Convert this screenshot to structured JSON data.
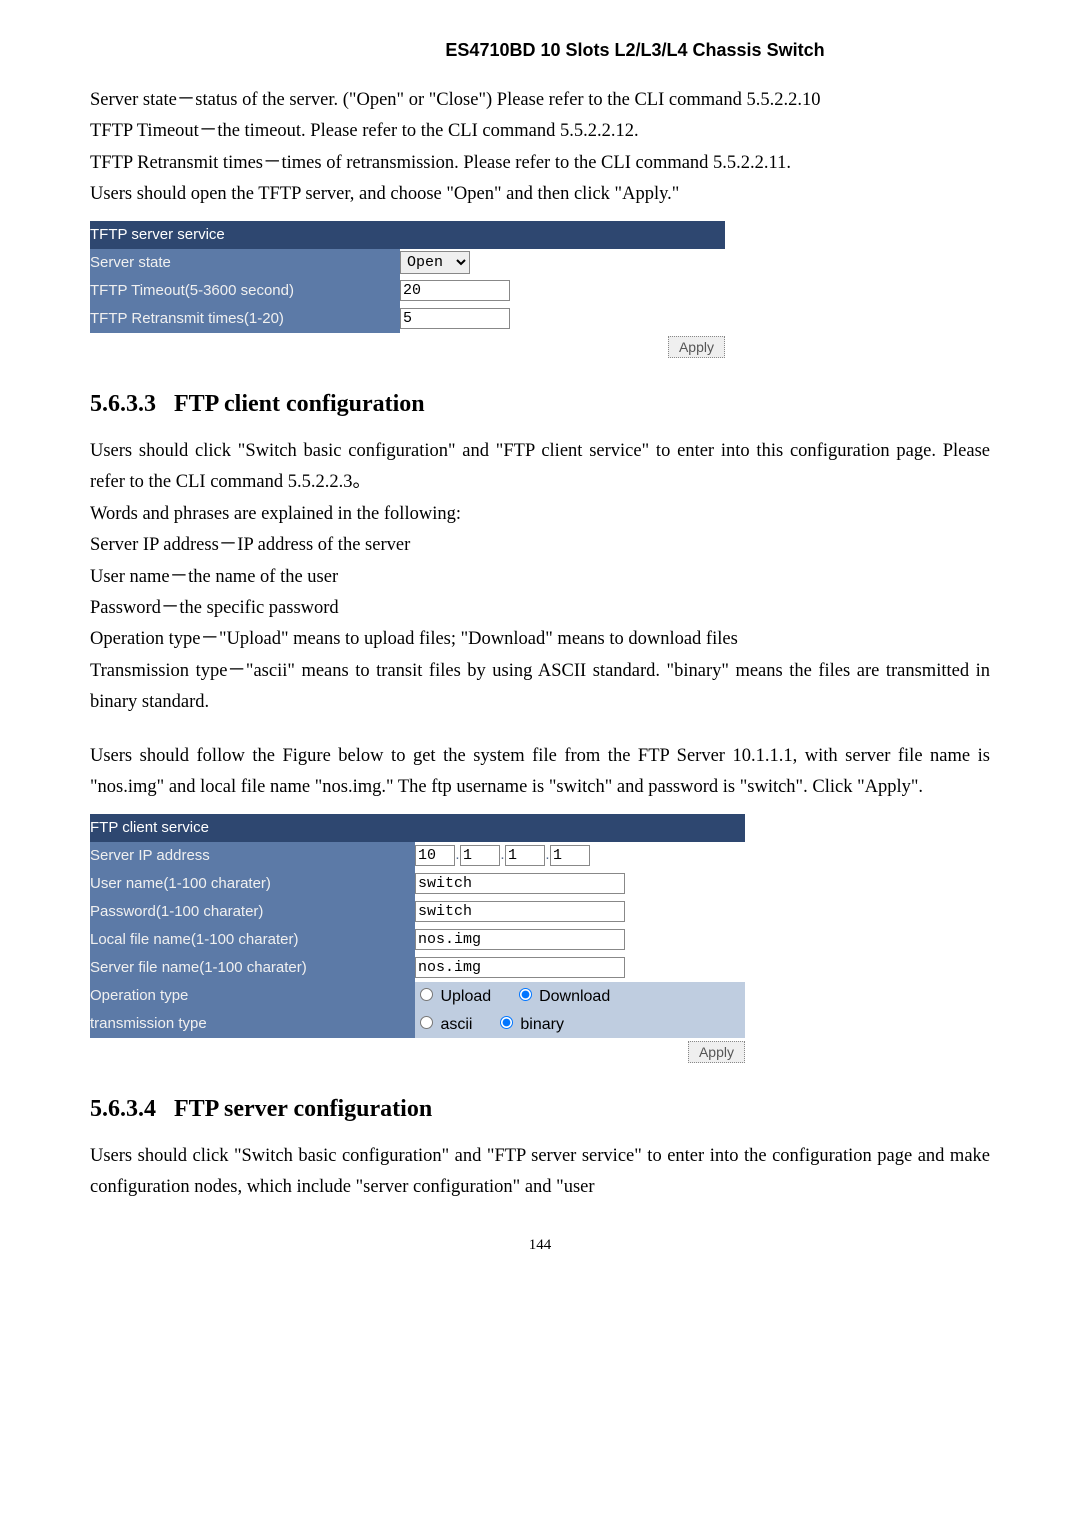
{
  "header": {
    "title": "ES4710BD 10 Slots L2/L3/L4 Chassis Switch"
  },
  "intro": {
    "p1": "Server state－status of the server. (\"Open\" or \"Close\") Please refer to the CLI command 5.5.2.2.10",
    "p2": "TFTP Timeout－the timeout. Please refer to the CLI command 5.5.2.2.12.",
    "p3": "TFTP Retransmit times－times of retransmission. Please refer to the CLI command 5.5.2.2.11.",
    "p4": "Users should open the TFTP server, and choose \"Open\" and then click \"Apply.\""
  },
  "tftp": {
    "title": "TFTP server service",
    "rows": {
      "state_label": "Server state",
      "state_value": "Open",
      "timeout_label": "TFTP Timeout(5-3600 second)",
      "timeout_value": "20",
      "retrans_label": "TFTP Retransmit times(1-20)",
      "retrans_value": "5"
    },
    "apply": "Apply"
  },
  "sec563_3": {
    "num": "5.6.3.3",
    "title": "FTP client configuration",
    "p1": "Users should click \"Switch basic configuration\" and \"FTP client service\" to enter into this configuration page. Please refer to the CLI command 5.5.2.2.3。",
    "p2": "Words and phrases are explained in the following:",
    "p3": "Server IP address－IP address of the server",
    "p4": "User name－the name of the user",
    "p5": "Password－the specific password",
    "p6": "Operation type－\"Upload\" means to upload files; \"Download\" means to download files",
    "p7": "Transmission type－\"ascii\" means to transit files by using ASCII standard. \"binary\" means the files are transmitted in binary standard.",
    "p8": "Users should follow the Figure below to get the system file from the FTP Server 10.1.1.1, with server file name is \"nos.img\" and local file name \"nos.img.\" The ftp username is \"switch\" and password is \"switch\". Click \"Apply\"."
  },
  "ftpclient": {
    "title": "FTP client service",
    "ip_label": "Server IP address",
    "ip": {
      "a": "10",
      "b": "1",
      "c": "1",
      "d": "1"
    },
    "user_label": "User name(1-100 charater)",
    "user_value": "switch",
    "pass_label": "Password(1-100 charater)",
    "pass_value": "switch",
    "local_label": "Local file name(1-100 charater)",
    "local_value": "nos.img",
    "server_label": "Server file name(1-100 charater)",
    "server_value": "nos.img",
    "op_label": "Operation type",
    "op_upload": "Upload",
    "op_download": "Download",
    "tx_label": "transmission type",
    "tx_ascii": "ascii",
    "tx_binary": "binary",
    "apply": "Apply"
  },
  "sec563_4": {
    "num": "5.6.3.4",
    "title": "FTP server configuration",
    "p1": "Users should click \"Switch basic configuration\" and \"FTP server service\" to enter into the configuration page and make configuration nodes, which include \"server configuration\" and \"user"
  },
  "footer": {
    "pagenum": "144"
  }
}
